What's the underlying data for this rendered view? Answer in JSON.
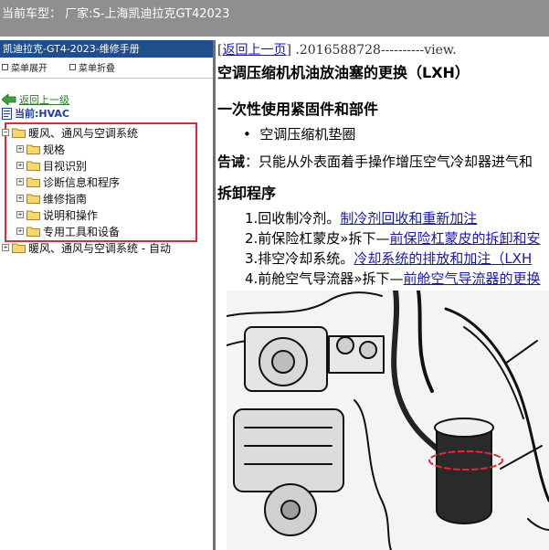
{
  "app": {
    "title": "当前车型：  厂家:S-上海凯迪拉克GT42023"
  },
  "left": {
    "manual_title": "凯迪拉克-GT4-2023-维修手册",
    "expand_all": "菜单展开",
    "collapse_all": "菜单折叠",
    "back_up": "返回上一级",
    "current": "当前:HVAC",
    "tree": [
      {
        "label": "暖风、通风与空调系统",
        "level": 0,
        "expander": "−"
      },
      {
        "label": "规格",
        "level": 1,
        "expander": "+"
      },
      {
        "label": "目视识别",
        "level": 1,
        "expander": "+"
      },
      {
        "label": "诊断信息和程序",
        "level": 1,
        "expander": "+"
      },
      {
        "label": "维修指南",
        "level": 1,
        "expander": "+"
      },
      {
        "label": "说明和操作",
        "level": 1,
        "expander": "+"
      },
      {
        "label": "专用工具和设备",
        "level": 1,
        "expander": "+"
      },
      {
        "label": "暖风、通风与空调系统 - 自动",
        "level": 0,
        "expander": "+"
      }
    ],
    "highlight_color": "#e2283b"
  },
  "doc": {
    "back_link": "返回上一页",
    "doc_id": ".2016588728----------view.",
    "title": "空调压缩机机油放油塞的更换（LXH）",
    "fasteners_heading": "一次性使用紧固件和部件",
    "fasteners": [
      "空调压缩机垫圈"
    ],
    "caution_label": "告诫",
    "caution_text": "：只能从外表面着手操作增压空气冷却器进气和",
    "procedure_heading": "拆卸程序",
    "steps": [
      {
        "text": "1.回收制冷剂。",
        "link": "制冷剂回收和重新加注"
      },
      {
        "text": "2.前保险杠蒙皮»拆下—",
        "link": "前保险杠蒙皮的拆卸和安"
      },
      {
        "text": "3.排空冷却系统。",
        "link": "冷却系统的排放和加注（LXH"
      },
      {
        "text": "4.前舱空气导流器»拆下—",
        "link": "前舱空气导流器的更换"
      }
    ],
    "link_color": "#1a1aa6"
  },
  "colors": {
    "titlebar": "#8f8f8f",
    "manual_header": "#1f4e8c"
  }
}
